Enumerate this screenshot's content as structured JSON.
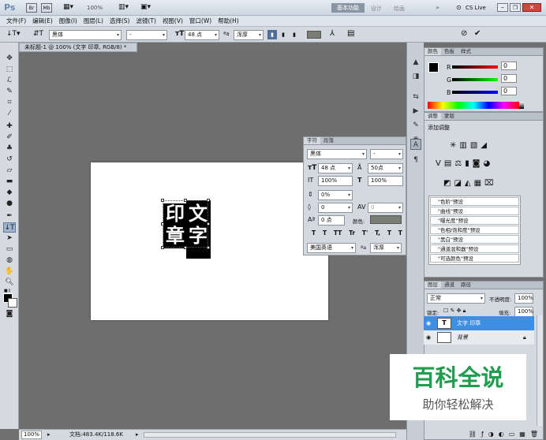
{
  "app": {
    "logo": "Ps",
    "zoom": "100%",
    "workspace": "基本功能",
    "ws_design": "设计",
    "ws_paint": "绘画",
    "cslive": "CS Live"
  },
  "menu": [
    "文件(F)",
    "编辑(E)",
    "图像(I)",
    "图层(L)",
    "选择(S)",
    "滤镜(T)",
    "视图(V)",
    "窗口(W)",
    "帮助(H)"
  ],
  "options": {
    "font_family": "黑体",
    "font_style": "-",
    "font_size": "48 点",
    "antialias": "浑厚",
    "text_color": "#7a7d74"
  },
  "document": {
    "tab_title": "未标题-1 @ 100% (文字 印章, RGB/8) *",
    "glyphs": [
      "印",
      "文",
      "章",
      "字"
    ]
  },
  "status": {
    "zoom": "100%",
    "doc_info": "文档:483.4K/118.6K"
  },
  "color_panel": {
    "tabs": [
      "颜色",
      "色板",
      "样式"
    ],
    "channels": [
      "R",
      "G",
      "B"
    ],
    "values": [
      "0",
      "0",
      "0"
    ]
  },
  "adjust_panel": {
    "tabs": [
      "调整",
      "蒙版"
    ],
    "title": "添加调整",
    "presets": [
      "\"色阶\"预设",
      "\"曲线\"预设",
      "\"曝光度\"预设",
      "\"色相/饱和度\"预设",
      "\"黑白\"预设",
      "\"通道混和器\"预设",
      "\"可选颜色\"预设"
    ]
  },
  "char_panel": {
    "tabs": [
      "字符",
      "段落"
    ],
    "font_family": "黑体",
    "font_style": "-",
    "font_size": "48 点",
    "leading": "50点",
    "vscale": "100%",
    "hscale": "100%",
    "baseline": "0%",
    "tracking": "0",
    "shift": "0 点",
    "color_label": "颜色:",
    "language": "美国英语",
    "antialias": "浑厚",
    "styles": [
      "T",
      "T",
      "TT",
      "Tr",
      "T'",
      "T,",
      "T",
      "T"
    ]
  },
  "layers_panel": {
    "tabs": [
      "图层",
      "通道",
      "路径"
    ],
    "blend": "正常",
    "opacity_label": "不透明度:",
    "opacity": "100%",
    "lock_label": "锁定:",
    "fill_label": "填充:",
    "fill": "100%",
    "layers": [
      {
        "name": "文字 印章",
        "type": "T"
      },
      {
        "name": "背景",
        "type": "bg"
      }
    ]
  },
  "watermark": {
    "title": "百科全说",
    "subtitle": "助你轻松解决"
  }
}
